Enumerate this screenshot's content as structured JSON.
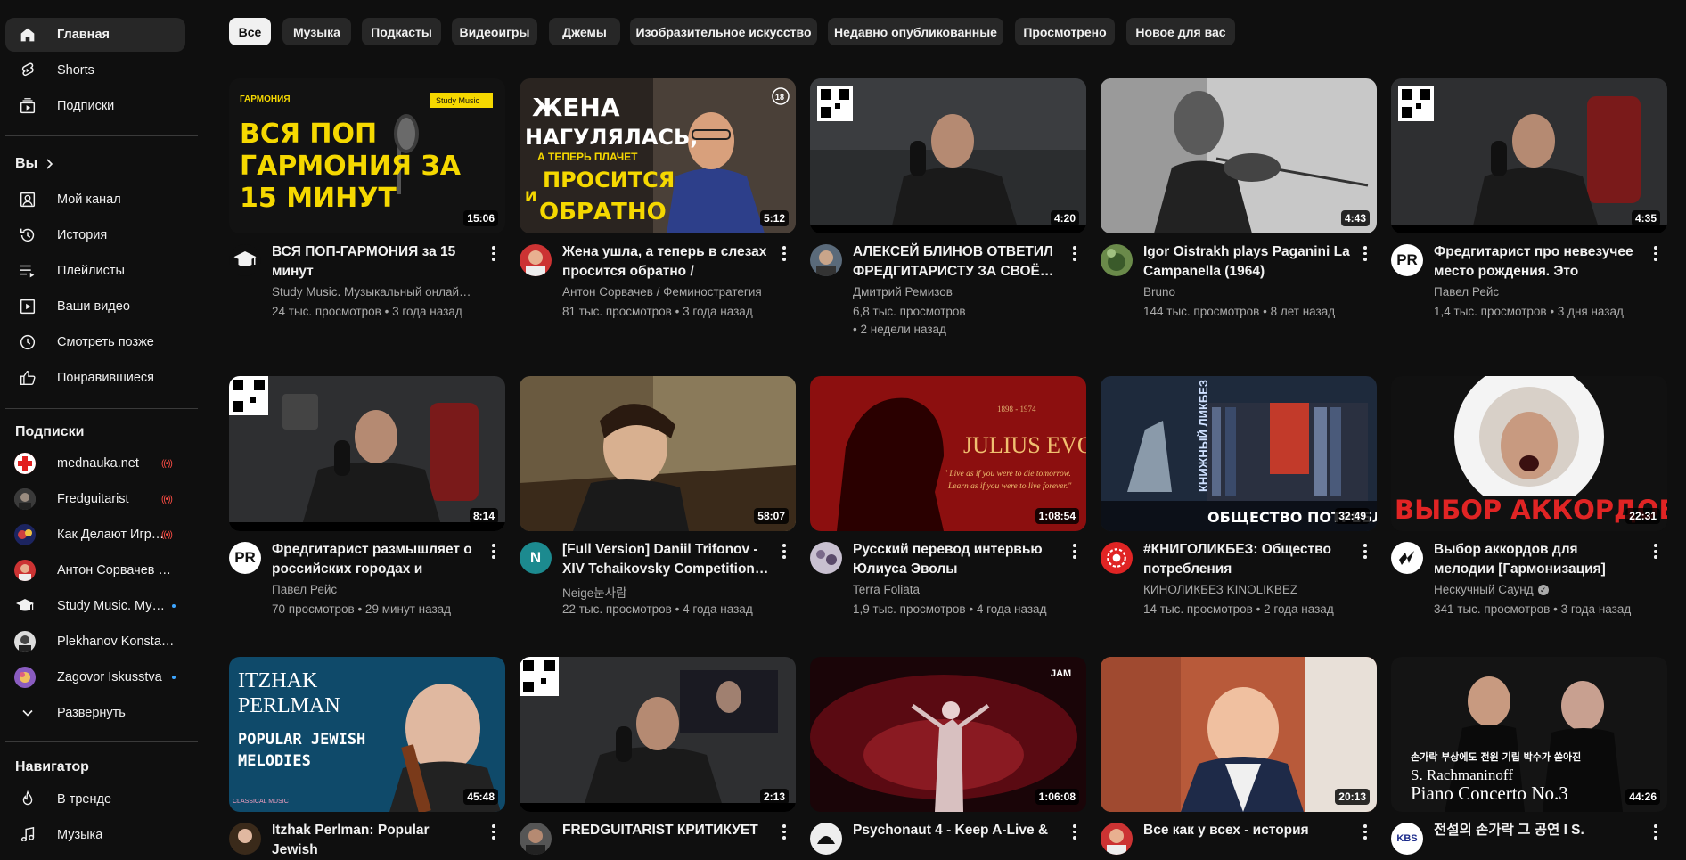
{
  "sidebar": {
    "main": [
      {
        "label": "Главная",
        "icon": "home-icon"
      },
      {
        "label": "Shorts",
        "icon": "shorts-icon"
      },
      {
        "label": "Подписки",
        "icon": "subscriptions-icon"
      }
    ],
    "you_heading": "Вы",
    "you": [
      {
        "label": "Мой канал",
        "icon": "channel-icon"
      },
      {
        "label": "История",
        "icon": "history-icon"
      },
      {
        "label": "Плейлисты",
        "icon": "playlists-icon"
      },
      {
        "label": "Ваши видео",
        "icon": "your-videos-icon"
      },
      {
        "label": "Смотреть позже",
        "icon": "watch-later-icon"
      },
      {
        "label": "Понравившиеся",
        "icon": "like-icon"
      }
    ],
    "subs_heading": "Подписки",
    "subscriptions": [
      {
        "label": "mednauka.net",
        "status": "live"
      },
      {
        "label": "Fredguitarist",
        "status": "live"
      },
      {
        "label": "Как Делают Игр…",
        "status": "live"
      },
      {
        "label": "Антон Сорвачев / …",
        "status": ""
      },
      {
        "label": "Study Music. Му…",
        "status": "new"
      },
      {
        "label": "Plekhanov Konstan…",
        "status": ""
      },
      {
        "label": "Zagovor Iskusstva",
        "status": "new"
      }
    ],
    "expand_label": "Развернуть",
    "navigator_heading": "Навигатор",
    "navigator": [
      {
        "label": "В тренде",
        "icon": "trending-icon"
      },
      {
        "label": "Музыка",
        "icon": "music-icon"
      }
    ]
  },
  "chips": [
    "Все",
    "Музыка",
    "Подкасты",
    "Видеоигры",
    "Джемы",
    "Изобразительное искусство",
    "Недавно опубликованные",
    "Просмотрено",
    "Новое для вас"
  ],
  "thumb_text": {
    "v0": {
      "tag": "ГАРМОНИЯ",
      "badge": "Study Music",
      "l1": "ВСЯ ПОП",
      "l2": "ГАРМОНИЯ ЗА",
      "l3": "15 МИНУТ"
    },
    "v1": {
      "l1": "ЖЕНА",
      "l2": "НАГУЛЯЛАСЬ,",
      "l3": "А ТЕПЕРЬ ПЛАЧЕТ",
      "l4": "ПРОСИТСЯ",
      "l5": "И",
      "l6": "ОБРАТНО",
      "age": "18"
    },
    "v7": {
      "years": "1898 - 1974",
      "name": "JULIUS EVOLA",
      "q1": "\" Live as if you were to die tomorrow.",
      "q2": "Learn as if you were to live forever.\""
    },
    "v8": {
      "vert": "КНИЖНЫЙ ЛИКБЕЗ",
      "bottom": "ОБЩЕСТВО ПОТРЕБЛ"
    },
    "v9": {
      "big": "ВЫБОР АККОРДОВ"
    },
    "v10": {
      "l1": "ITZHAK",
      "l2": "PERLMAN",
      "l3": "POPULAR JEWISH",
      "l4": "MELODIES",
      "foot": "CLASSICAL MUSIC"
    },
    "v14": {
      "korean": "손가락 부상에도 전원 기립 박수가 쏟아진",
      "l1": "S. Rachmaninoff",
      "l2": "Piano Concerto No.3"
    }
  },
  "videos": [
    {
      "title": "ВСЯ ПОП-ГАРМОНИЯ за 15 минут",
      "channel": "Study Music. Музыкальный онлай…",
      "meta": "24 тыс. просмотров • 3 года назад",
      "duration": "15:06"
    },
    {
      "title": "Жена ушла, а теперь в слезах просится обратно / психолог…",
      "channel": "Антон Сорвачев / Феминостратегия",
      "meta": "81 тыс. просмотров • 3 года назад",
      "duration": "5:12"
    },
    {
      "title": "АЛЕКСЕЙ БЛИНОВ ОТВЕТИЛ ФРЕДГИТАРИСТУ ЗА СВОЁ…",
      "channel": "Дмитрий Ремизов",
      "meta": "6,8 тыс. просмотров\n • 2 недели назад",
      "duration": "4:20"
    },
    {
      "title": "Igor Oistrakh plays Paganini La Campanella (1964)",
      "channel": "Bruno",
      "meta": "144 тыс. просмотров • 8 лет назад",
      "duration": "4:43"
    },
    {
      "title": "Фредгитарист про невезучее место рождения. Это судьба?…",
      "channel": "Павел Рейс",
      "meta": "1,4 тыс. просмотров • 3 дня назад",
      "duration": "4:35"
    },
    {
      "title": "Фредгитарист размышляет о российских городах и уровне…",
      "channel": "Павел Рейс",
      "meta": "70 просмотров • 29 минут назад",
      "duration": "8:14"
    },
    {
      "title": "[Full Version] Daniil Trifonov - XIV Tchaikovsky Competition…",
      "channel": "Neige눈사람",
      "meta": "22 тыс. просмотров • 4 года назад",
      "duration": "58:07"
    },
    {
      "title": "Русский перевод интервью Юлиуса Эволы",
      "channel": "Terra Foliata",
      "meta": "1,9 тыс. просмотров • 4 года назад",
      "duration": "1:08:54"
    },
    {
      "title": "#КНИГОЛИКБЕЗ: Общество потребления",
      "channel": "КИНОЛИКБЕЗ KINOLIKBEZ",
      "meta": "14 тыс. просмотров • 2 года назад",
      "duration": "32:49"
    },
    {
      "title": "Выбор аккордов для мелодии [Гармонизация] Теория…",
      "channel": "Нескучный Саунд",
      "meta": "341 тыс. просмотров • 3 года назад",
      "duration": "22:31"
    },
    {
      "title": "Itzhak Perlman: Popular Jewish",
      "channel": "",
      "meta": "",
      "duration": "45:48"
    },
    {
      "title": "FREDGUITARIST КРИТИКУЕТ",
      "channel": "",
      "meta": "",
      "duration": "2:13"
    },
    {
      "title": "Psychonaut 4 - Keep A-Live &",
      "channel": "",
      "meta": "",
      "duration": "1:06:08"
    },
    {
      "title": "Все как у всех - история",
      "channel": "",
      "meta": "",
      "duration": "20:13"
    },
    {
      "title": "전설의 손가락 그 공연 I S.",
      "channel": "",
      "meta": "",
      "duration": "44:26"
    }
  ],
  "avatar_letters": {
    "v4": "PR",
    "v5": "PR",
    "v6": "N",
    "v14": "KBS"
  },
  "colors": {
    "bg": "#0f0f0f",
    "chip": "#272727",
    "active_chip": "#f1f1f1",
    "live": "#ff4e45",
    "meta": "#aaaaaa"
  }
}
